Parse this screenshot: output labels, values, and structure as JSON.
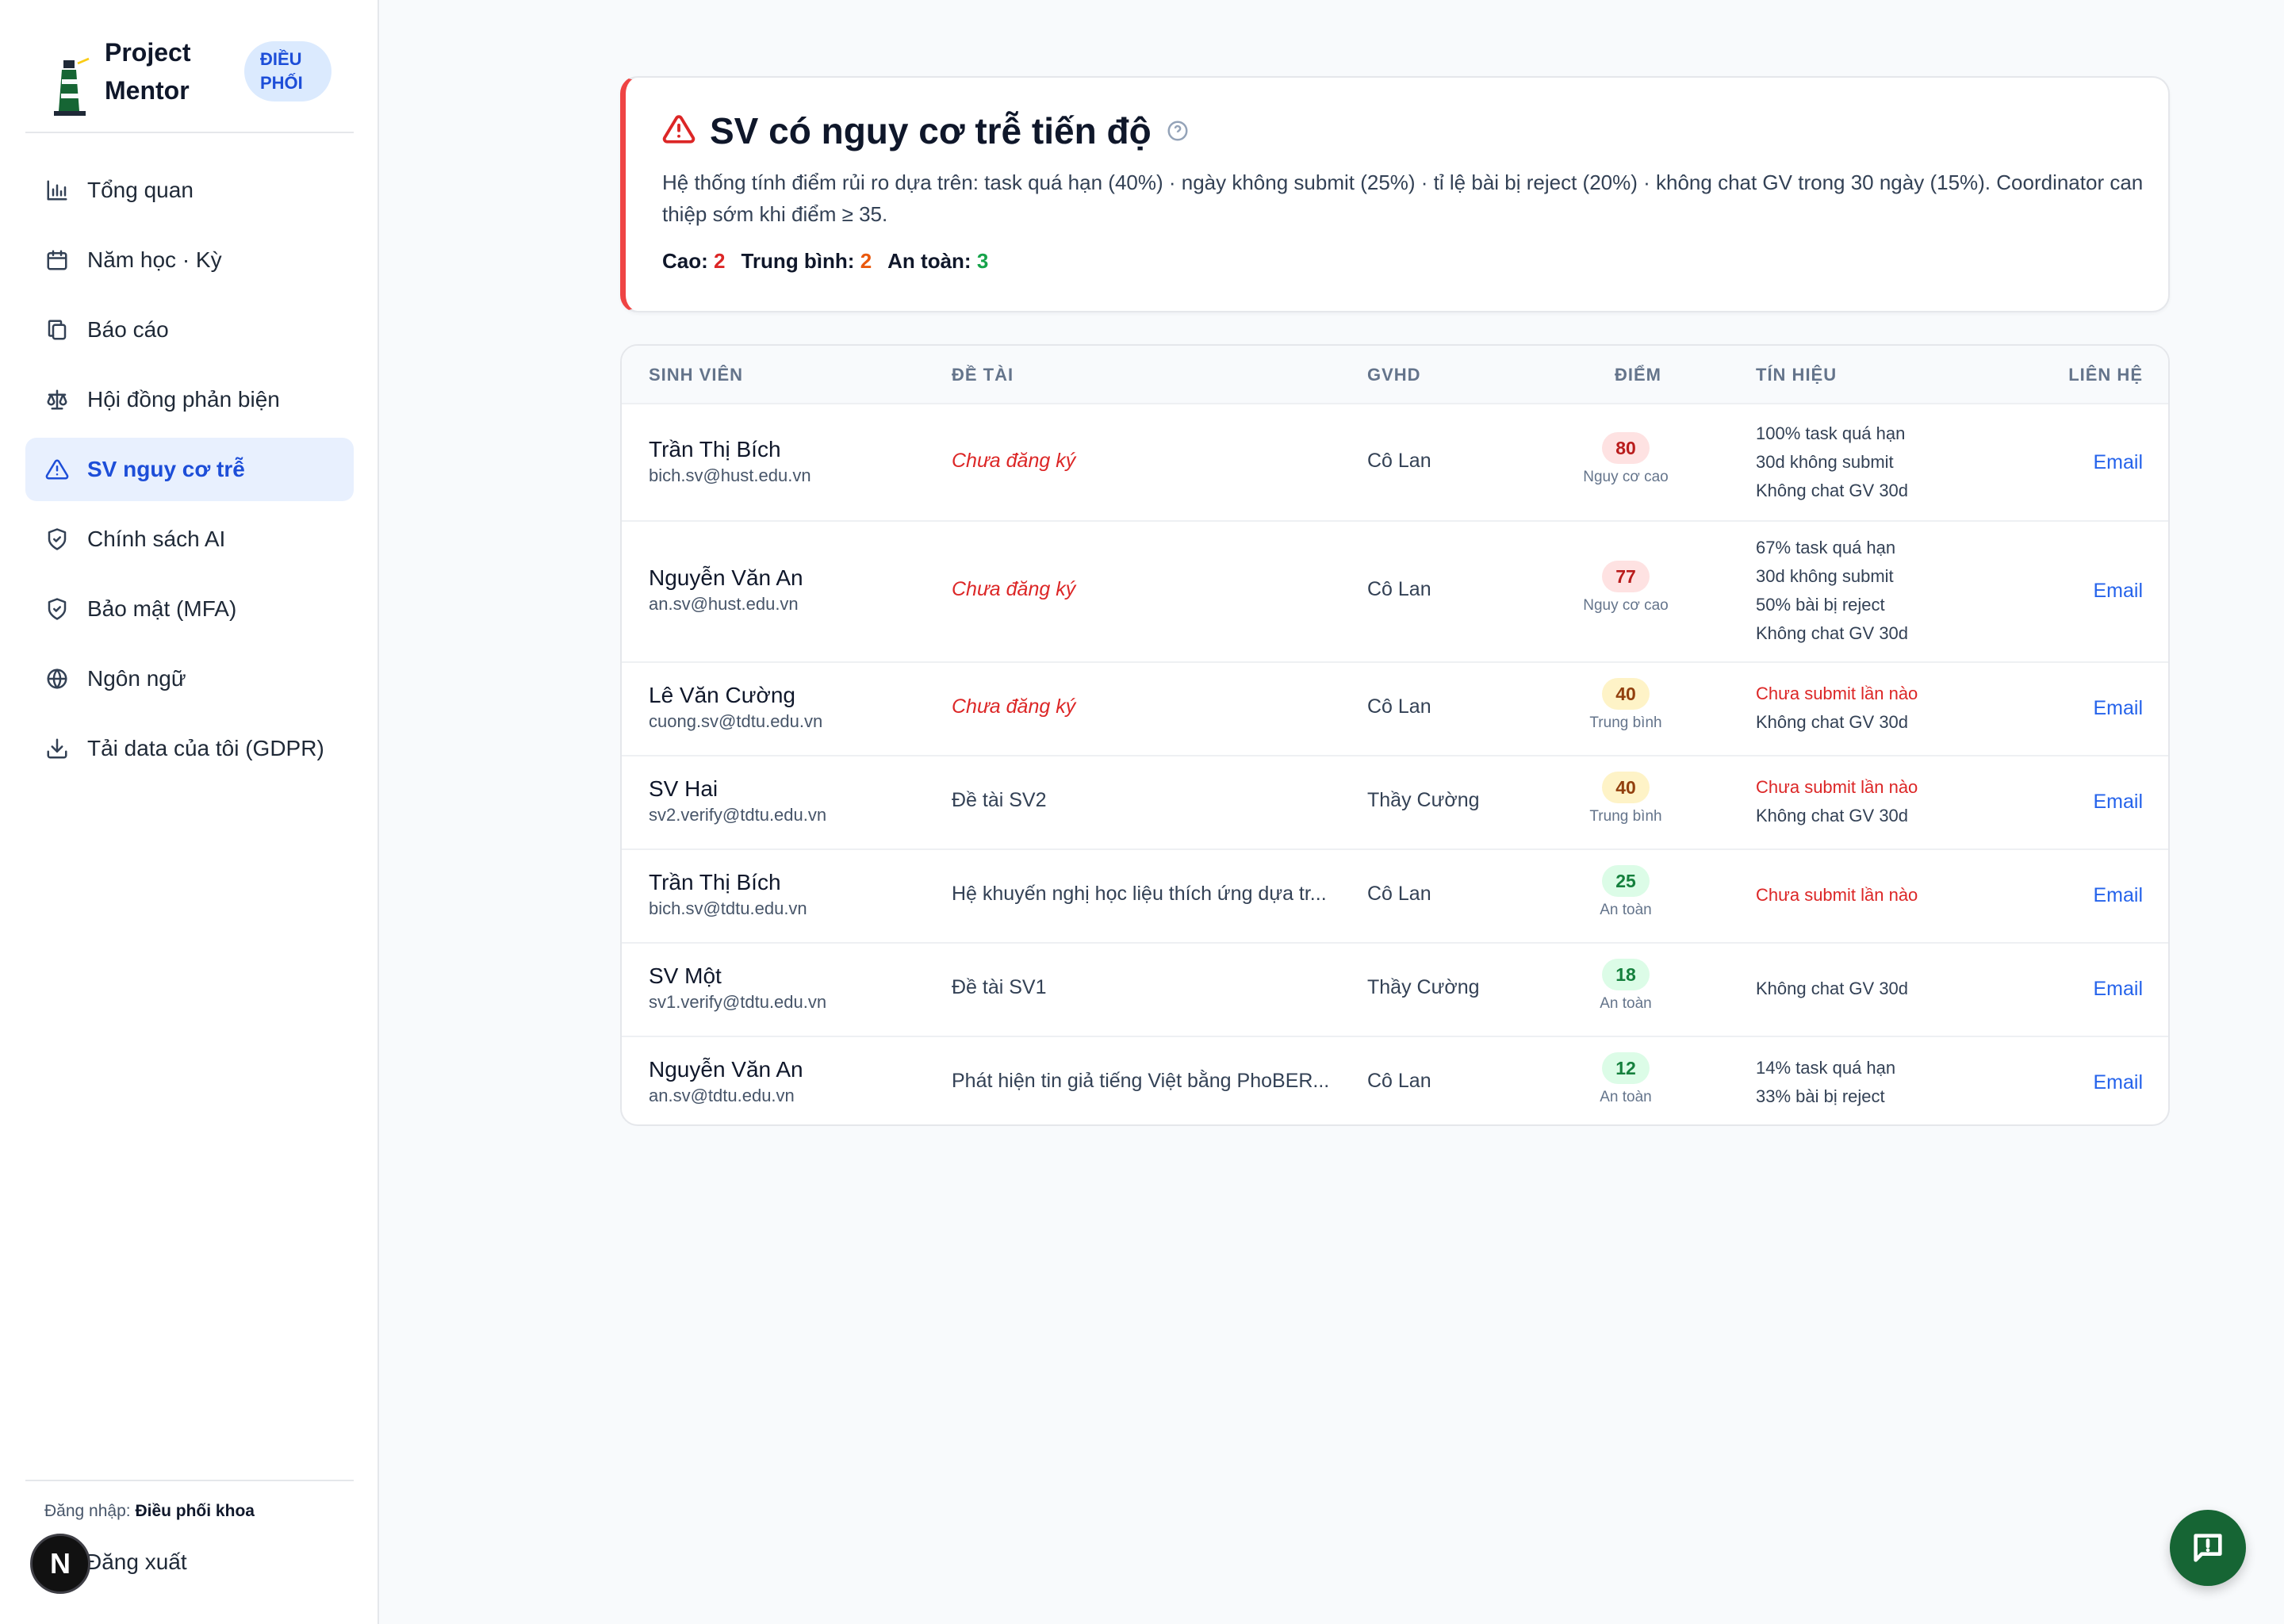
{
  "app": {
    "name_line1": "Project",
    "name_line2": "Mentor",
    "role_line1": "ĐIỀU",
    "role_line2": "PHỐI"
  },
  "nav": {
    "items": [
      {
        "label": "Tổng quan",
        "icon": "bar-chart-icon"
      },
      {
        "label": "Năm học · Kỳ",
        "icon": "calendar-icon"
      },
      {
        "label": "Báo cáo",
        "icon": "files-icon"
      },
      {
        "label": "Hội đồng phản biện",
        "icon": "scale-icon"
      },
      {
        "label": "SV nguy cơ trễ",
        "icon": "warning-icon",
        "active": true
      },
      {
        "label": "Chính sách AI",
        "icon": "shield-check-icon"
      },
      {
        "label": "Bảo mật (MFA)",
        "icon": "shield-icon"
      },
      {
        "label": "Ngôn ngữ",
        "icon": "globe-icon"
      },
      {
        "label": "Tải data của tôi (GDPR)",
        "icon": "download-icon"
      }
    ]
  },
  "session": {
    "login_prefix": "Đăng nhập:",
    "login_role": "Điều phối khoa",
    "logout_label": "Đăng xuất",
    "avatar_letter": "N"
  },
  "alert": {
    "title": "SV có nguy cơ trễ tiến độ",
    "description": "Hệ thống tính điểm rủi ro dựa trên: task quá hạn (40%) · ngày không submit (25%) · tỉ lệ bài bị reject (20%) · không chat GV trong 30 ngày (15%). Coordinator can thiệp sớm khi điểm ≥ 35.",
    "counts": [
      {
        "label": "Cao:",
        "value": "2",
        "color": "#dc2626"
      },
      {
        "label": "Trung bình:",
        "value": "2",
        "color": "#ea580c"
      },
      {
        "label": "An toàn:",
        "value": "3",
        "color": "#16a34a"
      }
    ]
  },
  "table": {
    "headers": {
      "student": "SINH VIÊN",
      "topic": "ĐỀ TÀI",
      "advisor": "GVHD",
      "score": "ĐIỂM",
      "signals": "TÍN HIỆU",
      "contact": "LIÊN HỆ"
    },
    "rows": [
      {
        "name": "Trần Thị Bích",
        "email": "bich.sv@hust.edu.vn",
        "topic": "Chưa đăng ký",
        "topic_missing": true,
        "advisor": "Cô Lan",
        "score": "80",
        "level": "high",
        "score_label": "Nguy cơ cao",
        "signals": [
          {
            "text": "100% task quá hạn"
          },
          {
            "text": "30d không submit"
          },
          {
            "text": "Không chat GV 30d"
          }
        ],
        "contact": "Email"
      },
      {
        "name": "Nguyễn Văn An",
        "email": "an.sv@hust.edu.vn",
        "topic": "Chưa đăng ký",
        "topic_missing": true,
        "advisor": "Cô Lan",
        "score": "77",
        "level": "high",
        "score_label": "Nguy cơ cao",
        "signals": [
          {
            "text": "67% task quá hạn"
          },
          {
            "text": "30d không submit"
          },
          {
            "text": "50% bài bị reject"
          },
          {
            "text": "Không chat GV 30d"
          }
        ],
        "contact": "Email"
      },
      {
        "name": "Lê Văn Cường",
        "email": "cuong.sv@tdtu.edu.vn",
        "topic": "Chưa đăng ký",
        "topic_missing": true,
        "advisor": "Cô Lan",
        "score": "40",
        "level": "mid",
        "score_label": "Trung bình",
        "signals": [
          {
            "text": "Chưa submit lần nào",
            "warn": true
          },
          {
            "text": "Không chat GV 30d"
          }
        ],
        "contact": "Email"
      },
      {
        "name": "SV Hai",
        "email": "sv2.verify@tdtu.edu.vn",
        "topic": "Đề tài SV2",
        "topic_missing": false,
        "advisor": "Thầy Cường",
        "score": "40",
        "level": "mid",
        "score_label": "Trung bình",
        "signals": [
          {
            "text": "Chưa submit lần nào",
            "warn": true
          },
          {
            "text": "Không chat GV 30d"
          }
        ],
        "contact": "Email"
      },
      {
        "name": "Trần Thị Bích",
        "email": "bich.sv@tdtu.edu.vn",
        "topic": "Hệ khuyến nghị học liệu thích ứng dựa tr...",
        "topic_missing": false,
        "advisor": "Cô Lan",
        "score": "25",
        "level": "low",
        "score_label": "An toàn",
        "signals": [
          {
            "text": "Chưa submit lần nào",
            "warn": true
          }
        ],
        "contact": "Email"
      },
      {
        "name": "SV Một",
        "email": "sv1.verify@tdtu.edu.vn",
        "topic": "Đề tài SV1",
        "topic_missing": false,
        "advisor": "Thầy Cường",
        "score": "18",
        "level": "low",
        "score_label": "An toàn",
        "signals": [
          {
            "text": "Không chat GV 30d"
          }
        ],
        "contact": "Email"
      },
      {
        "name": "Nguyễn Văn An",
        "email": "an.sv@tdtu.edu.vn",
        "topic": "Phát hiện tin giả tiếng Việt bằng PhoBER...",
        "topic_missing": false,
        "advisor": "Cô Lan",
        "score": "12",
        "level": "low",
        "score_label": "An toàn",
        "signals": [
          {
            "text": "14% task quá hạn"
          },
          {
            "text": "33% bài bị reject"
          }
        ],
        "contact": "Email"
      }
    ]
  },
  "chat": {
    "icon": "chat-alert-icon"
  }
}
